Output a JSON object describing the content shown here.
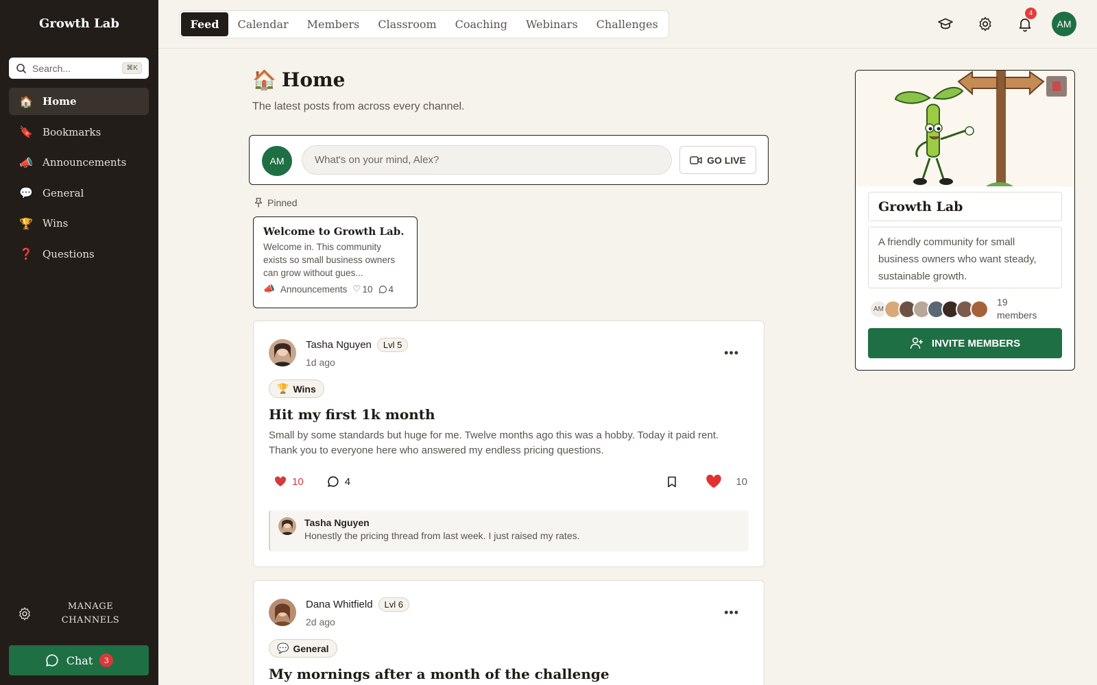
{
  "app": {
    "brand": "Growth Lab"
  },
  "sidebar": {
    "search_placeholder": "Search...",
    "search_shortcut": "⌘K",
    "items": [
      {
        "label": "Home",
        "emoji": "🏠",
        "active": true
      },
      {
        "label": "Bookmarks",
        "emoji": "🔖"
      },
      {
        "label": "Announcements",
        "emoji": "📣"
      },
      {
        "label": "General",
        "emoji": "💬"
      },
      {
        "label": "Wins",
        "emoji": "🏆"
      },
      {
        "label": "Questions",
        "emoji": "❓"
      }
    ],
    "manage_label": "MANAGE\nCHANNELS",
    "chat_label": "Chat",
    "chat_count": "3"
  },
  "topnav": {
    "tabs": [
      "Feed",
      "Calendar",
      "Members",
      "Classroom",
      "Coaching",
      "Webinars",
      "Challenges"
    ],
    "active_tab": "Feed",
    "notification_count": "4",
    "user_initials": "AM"
  },
  "main": {
    "title": "Home",
    "title_emoji": "🏠",
    "subtitle": "The latest posts from across every channel.",
    "composer": {
      "initials": "AM",
      "placeholder": "What's on your mind, Alex?",
      "go_live": "GO LIVE"
    },
    "pinned": {
      "label": "Pinned",
      "title": "Welcome to Growth Lab. ...",
      "body": "Welcome in. This community exists so small business owners can grow without gues...",
      "channel": "Announcements",
      "likes": "10",
      "comments": "4"
    },
    "posts": [
      {
        "author": "Tasha Nguyen",
        "level": "Lvl 5",
        "time": "1d ago",
        "channel": "Wins",
        "channel_emoji": "🏆",
        "title": "Hit my first 1k month",
        "body": "Small by some standards but huge for me. Twelve months ago this was a hobby. Today it paid rent. Thank you to everyone here who answered my endless pricing questions.",
        "likes": "10",
        "comments": "4",
        "reaction_count": "10",
        "reply": {
          "author": "Tasha Nguyen",
          "text": "Honestly the pricing thread from last week. I just raised my rates."
        }
      },
      {
        "author": "Dana Whitfield",
        "level": "Lvl 6",
        "time": "2d ago",
        "channel": "General",
        "channel_emoji": "💬",
        "title": "My mornings after a month of the challenge"
      }
    ]
  },
  "community": {
    "name": "Growth Lab",
    "description": "A friendly community for small business owners who want steady, sustainable growth.",
    "first_avatar_initials": "AM",
    "member_count": "19",
    "members_label": "members",
    "invite_label": "INVITE MEMBERS"
  },
  "colors": {
    "accent_green": "#1f6f45",
    "sidebar_bg": "#221d19",
    "page_bg": "#f6f3ec",
    "like_red": "#d63a3a"
  }
}
